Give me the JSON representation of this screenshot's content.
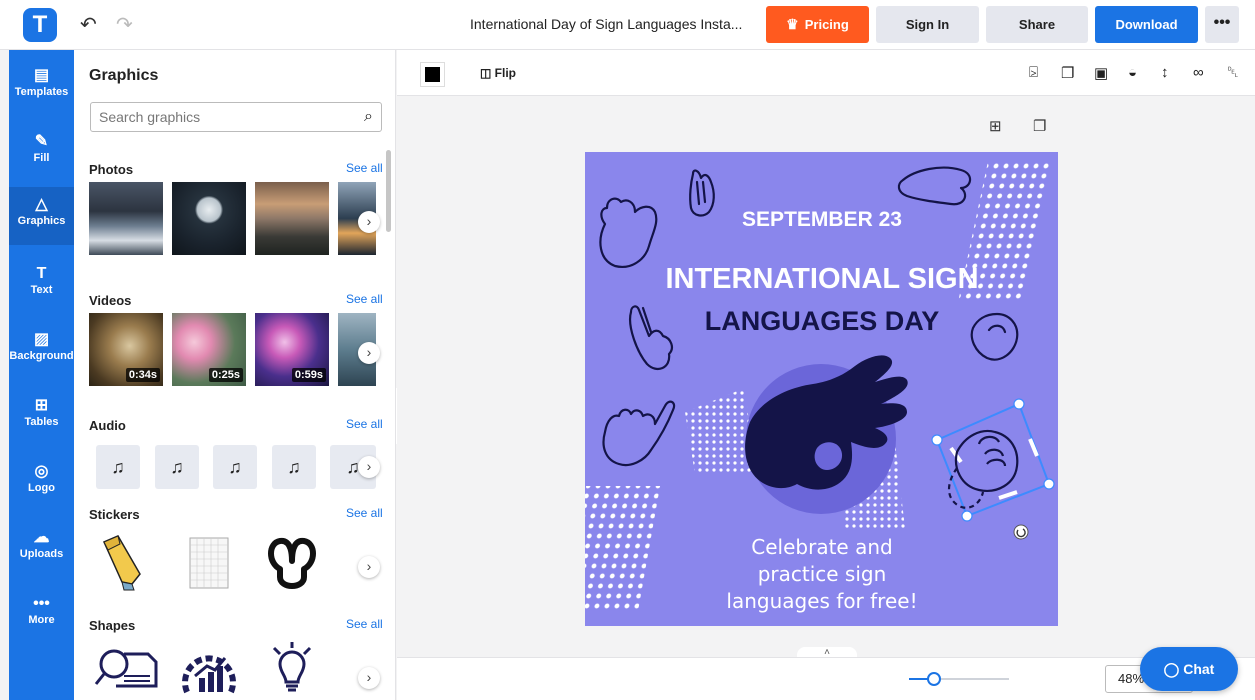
{
  "topbar": {
    "logo_letter": "T",
    "undo_icon": "undo-icon",
    "redo_icon": "redo-icon",
    "doc_title": "International Day of Sign Languages Insta...",
    "pricing_label": "Pricing",
    "signin_label": "Sign In",
    "share_label": "Share",
    "download_label": "Download",
    "more_label": "•••"
  },
  "rail": {
    "items": [
      {
        "label": "Templates",
        "icon": "▤"
      },
      {
        "label": "Fill",
        "icon": "✎"
      },
      {
        "label": "Graphics",
        "icon": "△"
      },
      {
        "label": "Text",
        "icon": "T"
      },
      {
        "label": "Background",
        "icon": "▨"
      },
      {
        "label": "Tables",
        "icon": "⊞"
      },
      {
        "label": "Logo",
        "icon": "◎"
      },
      {
        "label": "Uploads",
        "icon": "☁"
      },
      {
        "label": "More",
        "icon": "•••"
      }
    ],
    "active": "Graphics"
  },
  "panel": {
    "title": "Graphics",
    "search_placeholder": "Search graphics",
    "sections": {
      "photos": {
        "title": "Photos",
        "see_all": "See all"
      },
      "videos": {
        "title": "Videos",
        "see_all": "See all",
        "durations": [
          "0:34s",
          "0:25s",
          "0:59s"
        ]
      },
      "audio": {
        "title": "Audio",
        "see_all": "See all"
      },
      "stickers": {
        "title": "Stickers",
        "see_all": "See all"
      },
      "shapes": {
        "title": "Shapes",
        "see_all": "See all"
      }
    }
  },
  "toolbar": {
    "color": "#000000",
    "flip_label": "Flip"
  },
  "design": {
    "date": "SEPTEMBER 23",
    "title_line1": "INTERNATIONAL SIGN",
    "title_line2": "LANGUAGES DAY",
    "tagline_line1": "Celebrate and",
    "tagline_line2": "practice sign",
    "tagline_line3": "languages for free!",
    "bg_color": "#8a86ec",
    "accent_dark": "#141448"
  },
  "bottom": {
    "zoom_label": "48%",
    "chat_label": "Chat"
  },
  "colors": {
    "brand": "#1b74e4",
    "pricing": "#ff5a1f"
  }
}
